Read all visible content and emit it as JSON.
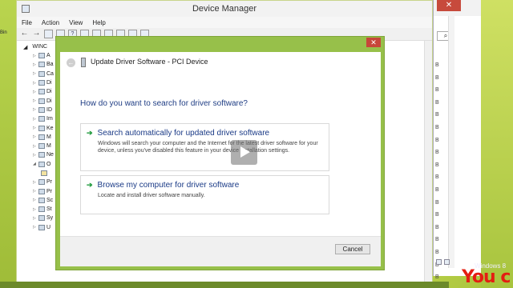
{
  "desktop": {
    "recycle_label": "Bin"
  },
  "device_manager": {
    "title": "Device Manager",
    "menu": [
      "File",
      "Action",
      "View",
      "Help"
    ],
    "tree_root": "WINC",
    "tree_items": [
      "A",
      "Ba",
      "Ca",
      "Di",
      "Di",
      "Di",
      "ID",
      "Im",
      "Ke",
      "M",
      "M",
      "Ne",
      "O",
      "",
      "Pr",
      "Pr",
      "Sc",
      "St",
      "Sy",
      "U"
    ]
  },
  "background_window": {
    "column_letter": "B",
    "row_count": 18
  },
  "dialog": {
    "close_symbol": "✕",
    "title": "Update Driver Software - PCI Device",
    "question": "How do you want to search for driver software?",
    "option1_title": "Search automatically for updated driver software",
    "option1_desc": "Windows will search your computer and the Internet for the latest driver software for your device, unless you've disabled this feature in your device installation settings.",
    "option2_title": "Browse my computer for driver software",
    "option2_desc": "Locate and install driver software manually.",
    "cancel_label": "Cancel"
  },
  "watermark": {
    "windows_label": "Windows 8",
    "brand": "You c"
  },
  "colors": {
    "dialog_frame": "#97c04a",
    "link_blue": "#1a3a86",
    "arrow_green": "#1f9a3c",
    "close_red": "#c7473a"
  },
  "icons": {
    "back": "back-arrow-icon",
    "play": "play-icon",
    "device": "device-icon",
    "green_arrow": "green-arrow-icon"
  }
}
